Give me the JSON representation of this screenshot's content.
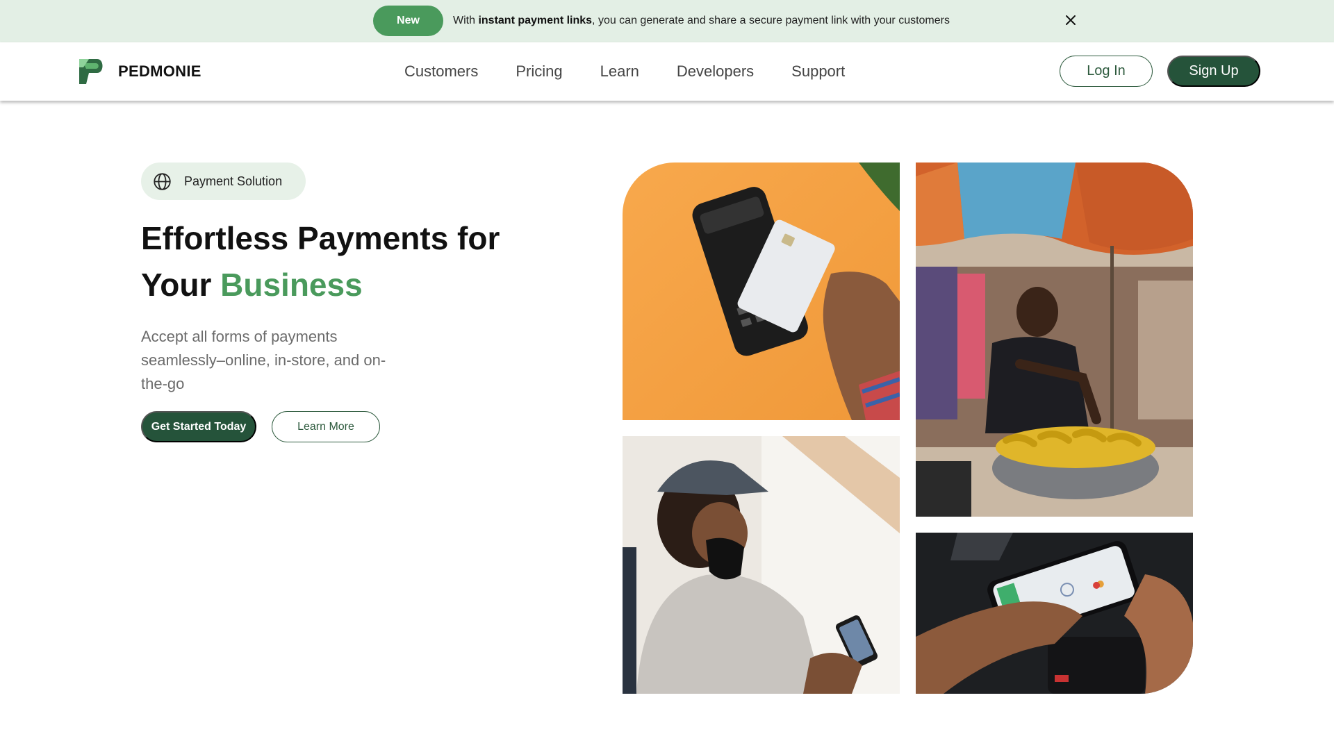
{
  "announcement": {
    "badge": "New",
    "text_prefix": "With ",
    "text_bold": "instant payment links",
    "text_suffix": ", you can generate and share a secure payment link with your customers",
    "close_icon": "close-icon"
  },
  "nav": {
    "brand": "PEDMONIE",
    "links": [
      "Customers",
      "Pricing",
      "Learn",
      "Developers",
      "Support"
    ],
    "login_label": "Log In",
    "signup_label": "Sign Up"
  },
  "hero": {
    "pill_label": "Payment Solution",
    "pill_icon": "globe-icon",
    "title_line1": "Effortless Payments for",
    "title_line2_prefix": "Your ",
    "title_line2_accent": "Business",
    "subtitle": "Accept all forms of payments seamlessly–online, in-store, and on-the-go",
    "primary_cta": "Get Started Today",
    "secondary_cta": "Learn More"
  },
  "images": {
    "pos": "card-payment-terminal-photo",
    "market": "market-vendor-photo",
    "cap": "customer-phone-payment-photo",
    "phone": "contactless-phone-payment-photo"
  },
  "colors": {
    "brand_dark": "#25533a",
    "brand_accent": "#4a9a5c",
    "announce_bg": "#e3efe5",
    "pill_bg": "#e7f1e8"
  }
}
